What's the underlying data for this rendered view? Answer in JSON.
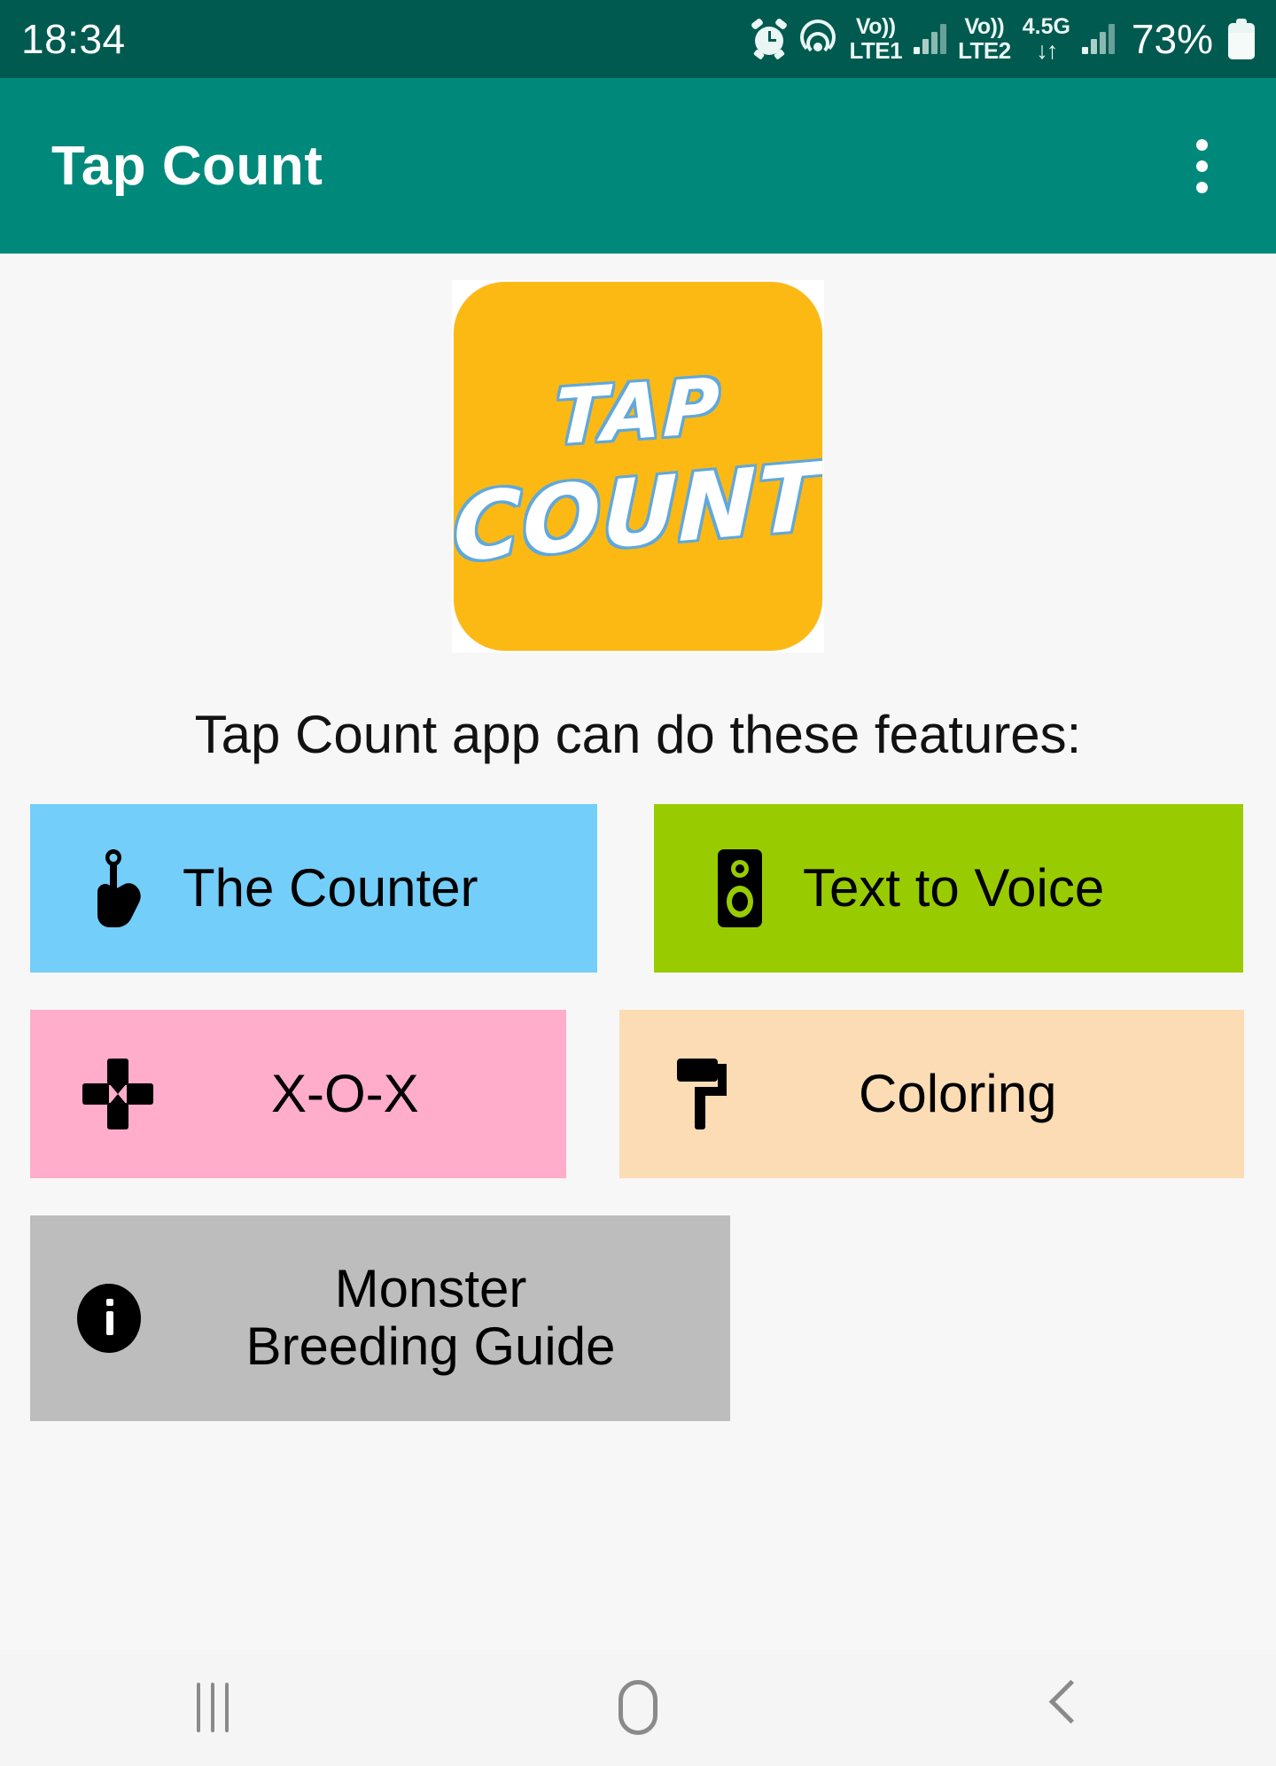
{
  "status_bar": {
    "time": "18:34",
    "alarm_icon": "alarm-clock-icon",
    "cast_icon": "nearby-share-icon",
    "sim1_label_top": "Vo))",
    "sim1_label_bottom": "LTE1",
    "sim2_label_top": "Vo))",
    "sim2_label_bottom": "LTE2",
    "data_rate_top": "4.5G",
    "data_rate_arrows": "↓↑",
    "battery_percent": "73%",
    "battery_icon": "battery-icon",
    "background_color": "#005a4f"
  },
  "app_bar": {
    "title": "Tap Count",
    "overflow_menu": "more-options",
    "background_color": "#00897b",
    "title_color": "#ffffff"
  },
  "logo": {
    "line1": "TAP",
    "line2": "COUNT",
    "background_color": "#FDB913",
    "text_color": "#ffffff",
    "outline_color": "#5fa8dc"
  },
  "main": {
    "heading": "Tap Count app can do these features:",
    "features": [
      {
        "label": "The Counter",
        "icon": "touch-tap-icon",
        "color": "#74CEFA"
      },
      {
        "label": "Text to Voice",
        "icon": "speaker-icon",
        "color": "#99CC00"
      },
      {
        "label": "X-O-X",
        "icon": "dpad-game-icon",
        "color": "#FFADCB"
      },
      {
        "label": "Coloring",
        "icon": "paint-roller-icon",
        "color": "#FCDCB4"
      },
      {
        "label": "Monster\nBreeding Guide",
        "label_line1": "Monster",
        "label_line2": "Breeding Guide",
        "icon": "info-icon",
        "color": "#BDBDBD"
      }
    ]
  },
  "nav_bar": {
    "recents_label": "recent-apps",
    "home_label": "home",
    "back_label": "back",
    "background_color": "#f5f5f5",
    "icon_color": "#8a8a8a"
  }
}
